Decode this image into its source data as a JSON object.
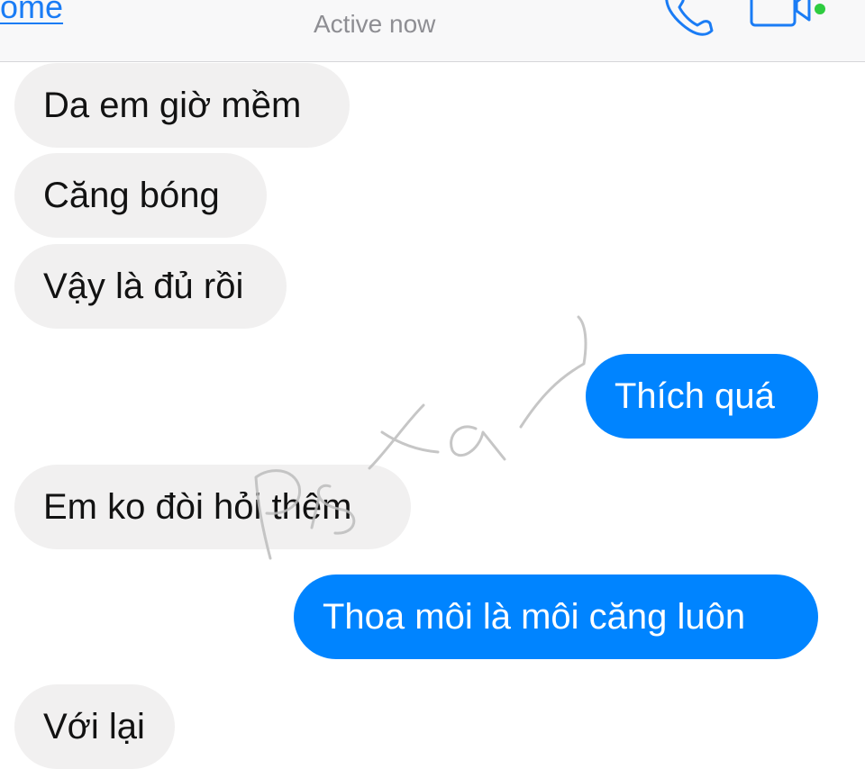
{
  "header": {
    "back_label": "ome",
    "status": "Active now",
    "call_icon": "phone-icon",
    "video_icon": "video-camera-icon",
    "online_color": "#2ecc40"
  },
  "messages": [
    {
      "from": "contact",
      "text": "Da em giờ mềm"
    },
    {
      "from": "contact",
      "text": "Căng bóng"
    },
    {
      "from": "contact",
      "text": "Vậy là đủ rồi"
    },
    {
      "from": "me",
      "text": "Thích quá"
    },
    {
      "from": "contact",
      "text": "Em ko đòi hỏi thêm"
    },
    {
      "from": "me",
      "text": "Thoa môi là môi căng luôn"
    },
    {
      "from": "contact",
      "text": "Với lại"
    }
  ],
  "watermark": {
    "text": "Pistar"
  },
  "colors": {
    "accent": "#1a7cf5",
    "outgoing_bubble": "#0084ff",
    "incoming_bubble": "#f1f0f0"
  }
}
